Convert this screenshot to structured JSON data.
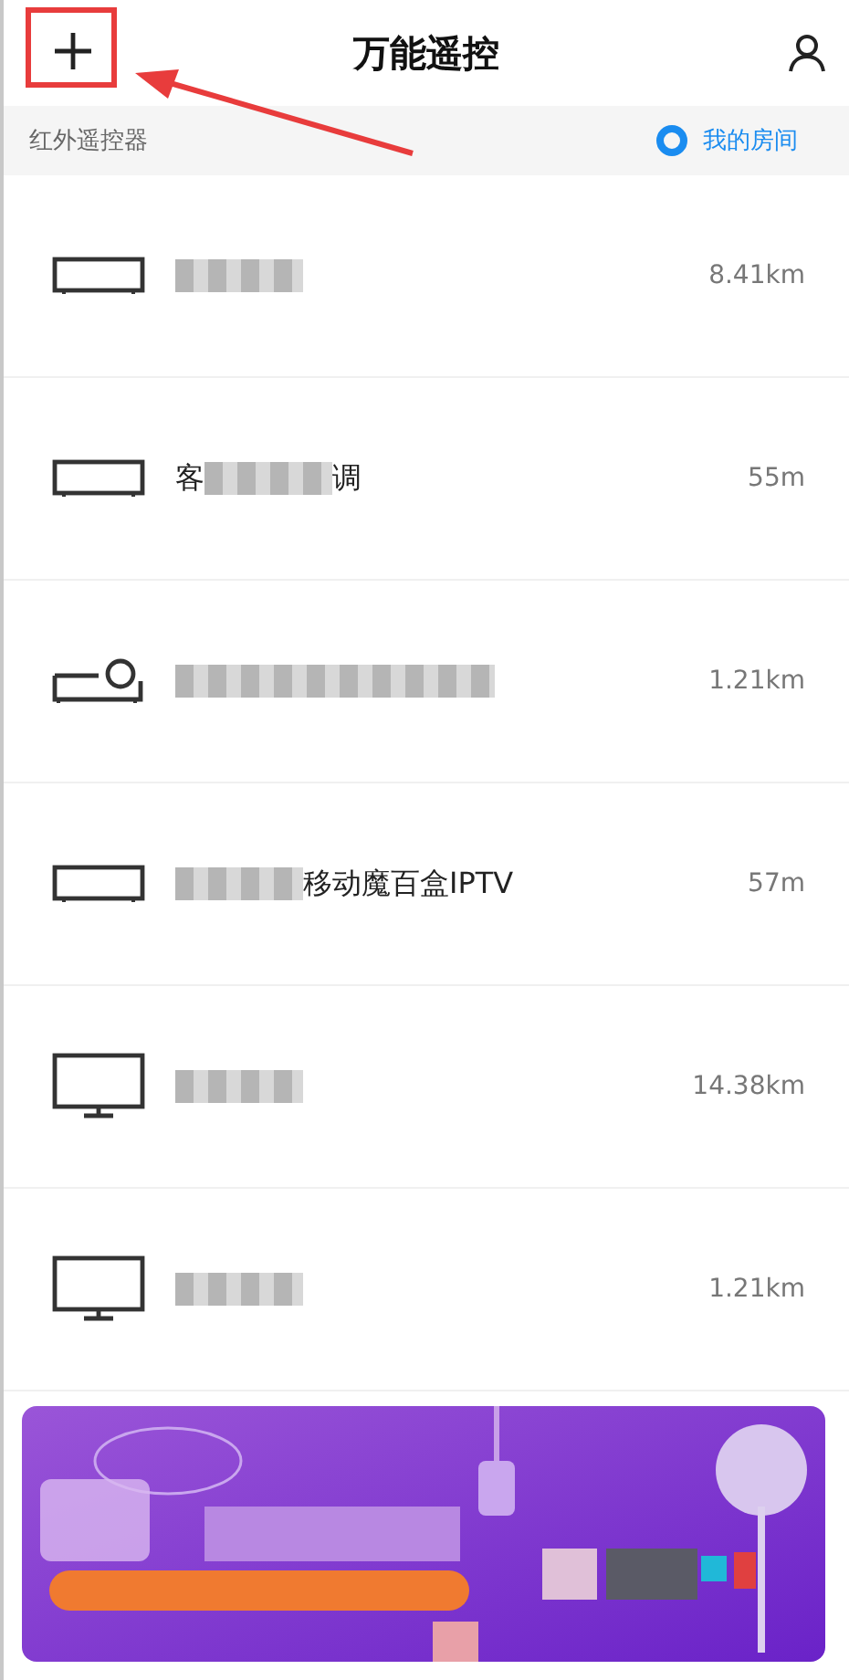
{
  "header": {
    "title": "万能遥控"
  },
  "section": {
    "label": "红外遥控器",
    "room_link": "我的房间"
  },
  "devices": [
    {
      "kind": "box",
      "name_parts": [
        {
          "kind": "blur"
        }
      ],
      "distance": "8.41km"
    },
    {
      "kind": "box",
      "name_parts": [
        {
          "kind": "text",
          "text": "客"
        },
        {
          "kind": "blur"
        },
        {
          "kind": "text",
          "text": "调"
        }
      ],
      "distance": "55m"
    },
    {
      "kind": "projector",
      "name_parts": [
        {
          "kind": "blur-long"
        }
      ],
      "distance": "1.21km"
    },
    {
      "kind": "box",
      "name_parts": [
        {
          "kind": "blur"
        },
        {
          "kind": "text",
          "text": "移动魔百盒IPTV"
        }
      ],
      "distance": "57m"
    },
    {
      "kind": "tv",
      "name_parts": [
        {
          "kind": "blur"
        }
      ],
      "distance": "14.38km"
    },
    {
      "kind": "tv",
      "name_parts": [
        {
          "kind": "blur"
        }
      ],
      "distance": "1.21km"
    }
  ]
}
